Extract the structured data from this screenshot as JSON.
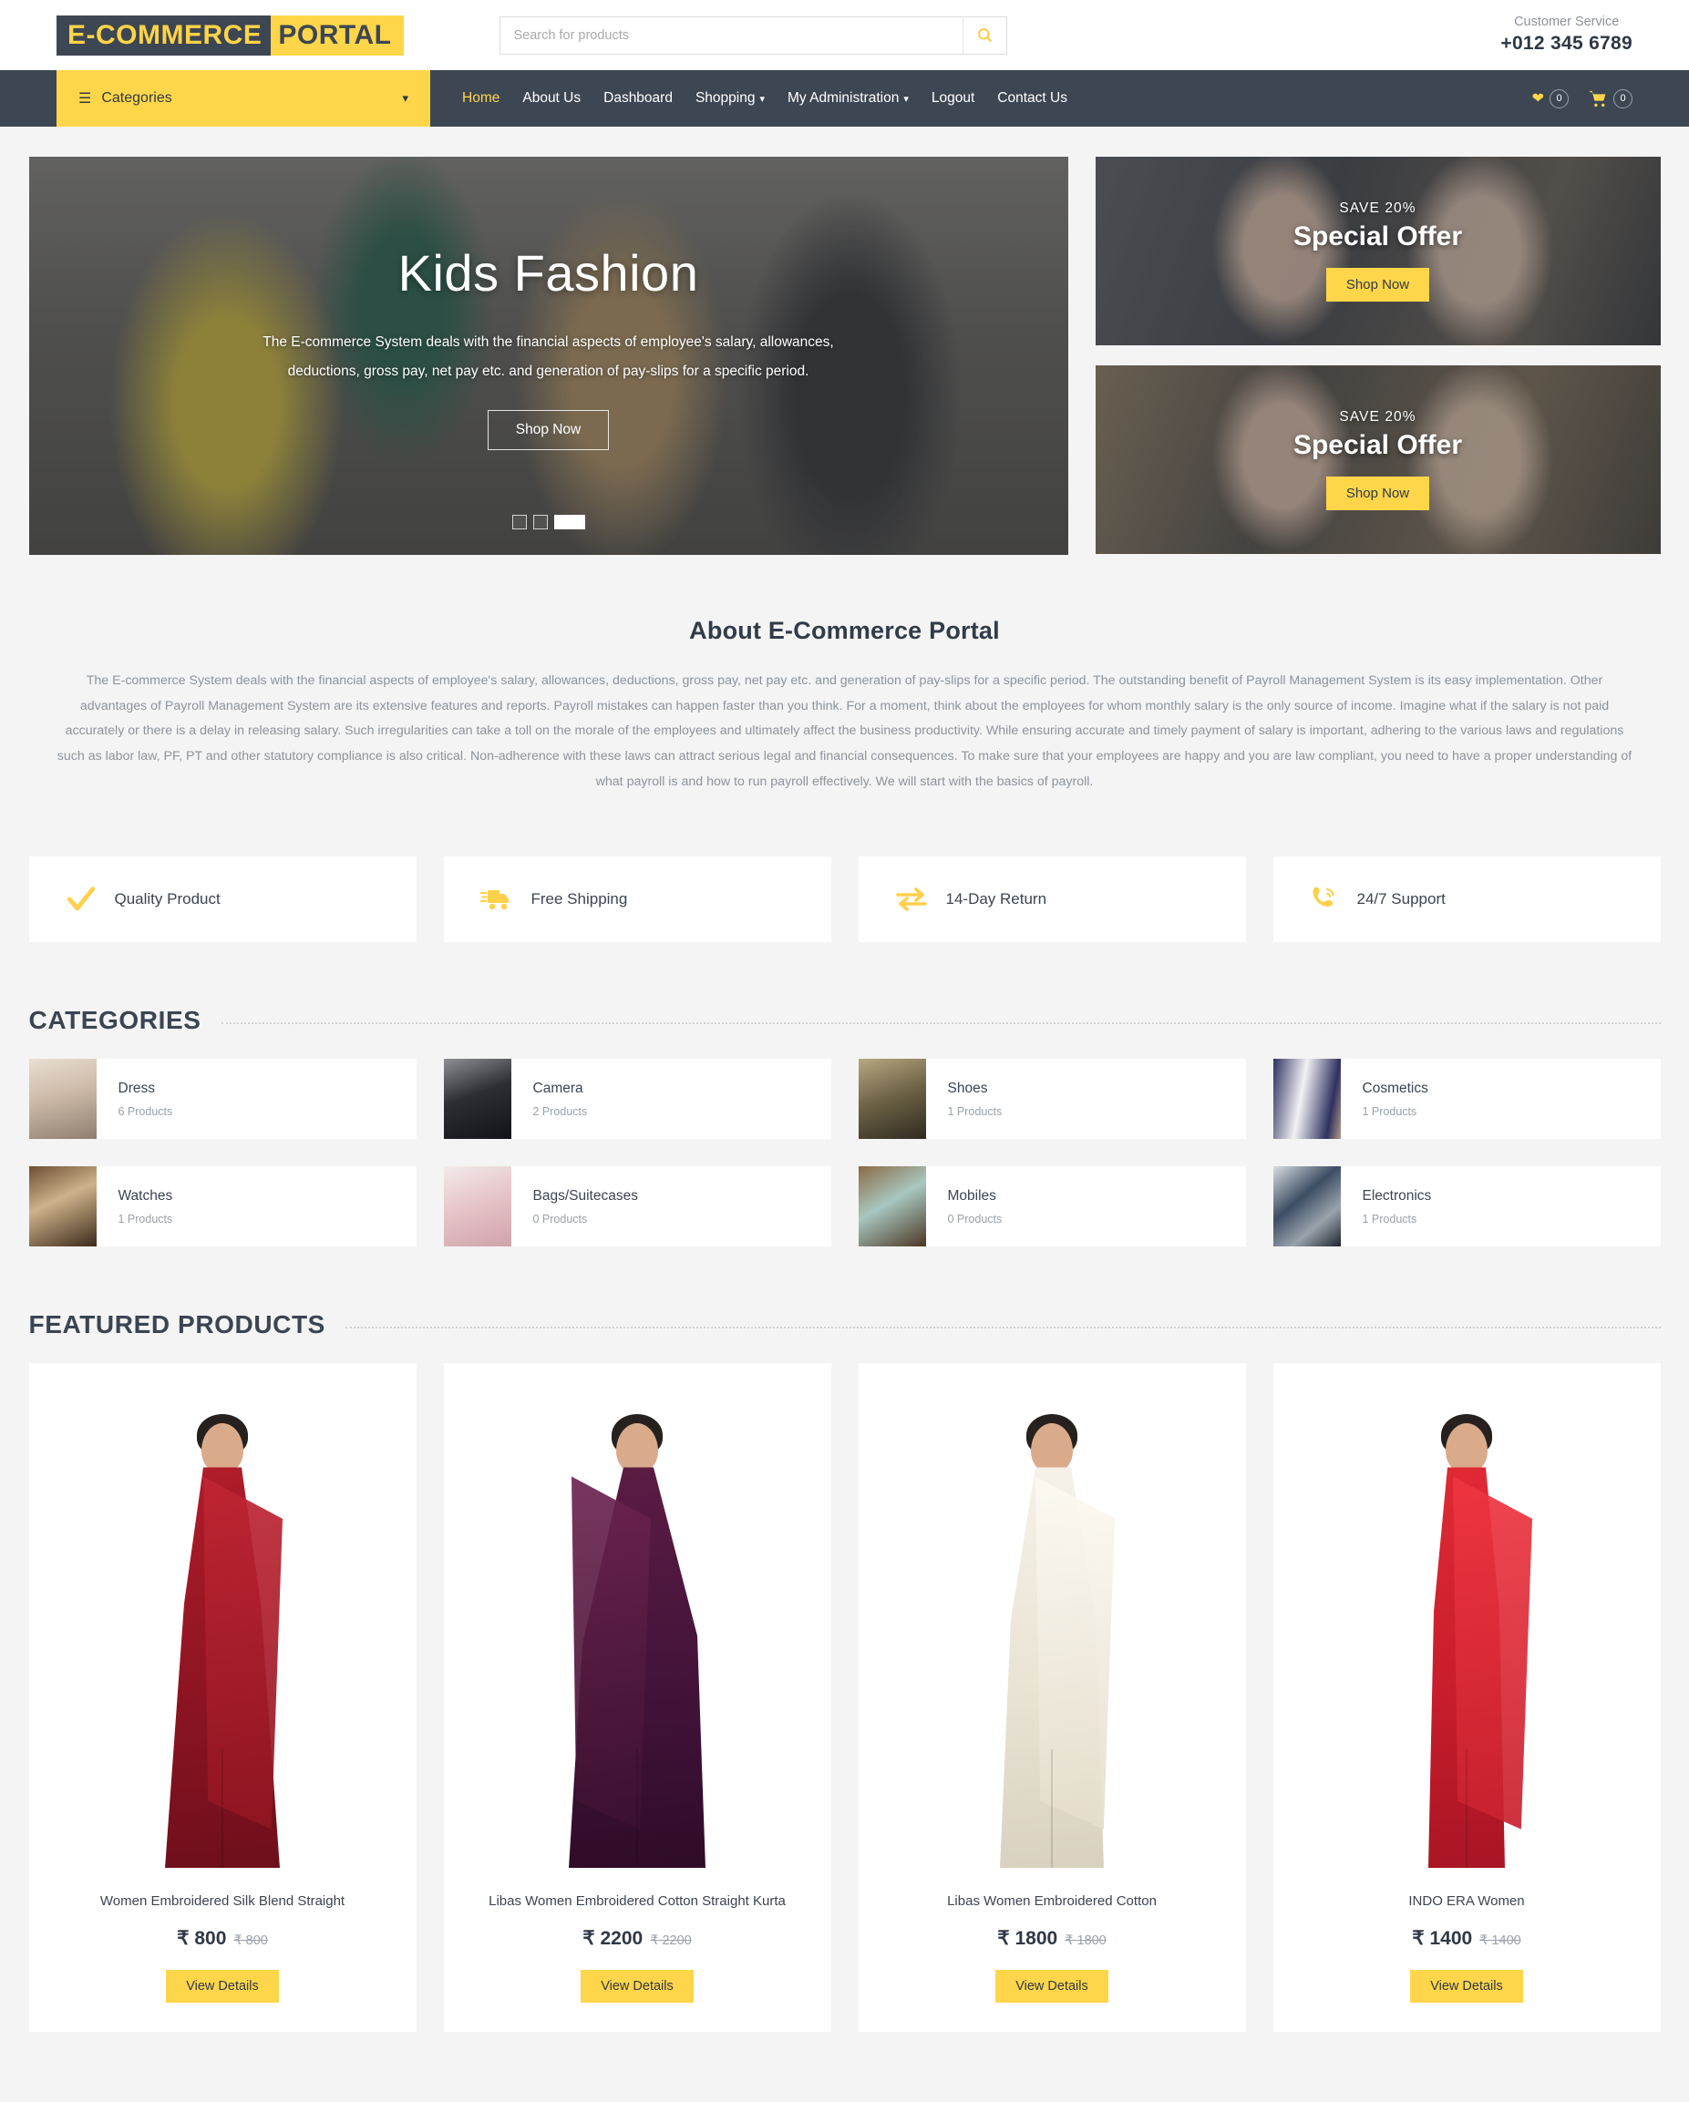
{
  "header": {
    "logo_part1": "E-COMMERCE",
    "logo_part2": "PORTAL",
    "search_placeholder": "Search for products",
    "search_value": "",
    "search_icon": "search-icon",
    "customer_service_label": "Customer Service",
    "customer_service_phone": "+012 345 6789"
  },
  "nav": {
    "categories_label": "Categories",
    "links": [
      {
        "label": "Home",
        "active": true,
        "caret": ""
      },
      {
        "label": "About Us",
        "active": false,
        "caret": ""
      },
      {
        "label": "Dashboard",
        "active": false,
        "caret": ""
      },
      {
        "label": "Shopping",
        "active": false,
        "caret": "⌄"
      },
      {
        "label": "My Administration",
        "active": false,
        "caret": "⌄"
      },
      {
        "label": "Logout",
        "active": false,
        "caret": ""
      },
      {
        "label": "Contact Us",
        "active": false,
        "caret": ""
      }
    ],
    "wishlist_count": "0",
    "cart_count": "0"
  },
  "hero": {
    "title": "Kids Fashion",
    "description": "The E-commerce System deals with the financial aspects of employee's salary, allowances, deductions, gross pay, net pay etc. and generation of pay-slips for a specific period.",
    "button": "Shop Now",
    "slides": [
      "slide-1",
      "slide-2",
      "slide-3"
    ],
    "active_slide": 2
  },
  "promos": [
    {
      "save": "SAVE 20%",
      "title": "Special Offer",
      "button": "Shop Now"
    },
    {
      "save": "SAVE 20%",
      "title": "Special Offer",
      "button": "Shop Now"
    }
  ],
  "about": {
    "title": "About E-Commerce Portal",
    "body": "The E-commerce System deals with the financial aspects of employee's salary, allowances, deductions, gross pay, net pay etc. and generation of pay-slips for a specific period. The outstanding benefit of Payroll Management System is its easy implementation. Other advantages of Payroll Management System are its extensive features and reports. Payroll mistakes can happen faster than you think. For a moment, think about the employees for whom monthly salary is the only source of income. Imagine what if the salary is not paid accurately or there is a delay in releasing salary. Such irregularities can take a toll on the morale of the employees and ultimately affect the business productivity. While ensuring accurate and timely payment of salary is important, adhering to the various laws and regulations such as labor law, PF, PT and other statutory compliance is also critical. Non-adherence with these laws can attract serious legal and financial consequences. To make sure that your employees are happy and you are law compliant, you need to have a proper understanding of what payroll is and how to run payroll effectively. We will start with the basics of payroll."
  },
  "features": [
    {
      "label": "Quality Product",
      "icon": "check-icon"
    },
    {
      "label": "Free Shipping",
      "icon": "truck-icon"
    },
    {
      "label": "14-Day Return",
      "icon": "exchange-arrows-icon"
    },
    {
      "label": "24/7 Support",
      "icon": "phone-support-icon"
    }
  ],
  "categories_section": {
    "title": "CATEGORIES",
    "items": [
      {
        "name": "Dress",
        "count": "6 Products",
        "thumb": "th-dress"
      },
      {
        "name": "Camera",
        "count": "2 Products",
        "thumb": "th-camera"
      },
      {
        "name": "Shoes",
        "count": "1 Products",
        "thumb": "th-shoes"
      },
      {
        "name": "Cosmetics",
        "count": "1 Products",
        "thumb": "th-cosmetics"
      },
      {
        "name": "Watches",
        "count": "1 Products",
        "thumb": "th-watches"
      },
      {
        "name": "Bags/Suitecases",
        "count": "0 Products",
        "thumb": "th-bags"
      },
      {
        "name": "Mobiles",
        "count": "0 Products",
        "thumb": "th-mobiles"
      },
      {
        "name": "Electronics",
        "count": "1 Products",
        "thumb": "th-electronics"
      }
    ]
  },
  "featured_section": {
    "title": "FEATURED PRODUCTS",
    "button_label": "View Details",
    "currency": "₹",
    "items": [
      {
        "name": "Women Embroidered Silk Blend Straight",
        "price": "₹ 800",
        "old_price": "₹ 800"
      },
      {
        "name": "Libas Women Embroidered Cotton Straight Kurta",
        "price": "₹ 2200",
        "old_price": "₹ 2200"
      },
      {
        "name": "Libas Women Embroidered Cotton",
        "price": "₹ 1800",
        "old_price": "₹ 1800"
      },
      {
        "name": "INDO ERA Women",
        "price": "₹ 1400",
        "old_price": "₹ 1400"
      }
    ]
  },
  "colors": {
    "accent": "#ffd64a",
    "dark": "#3d4653",
    "page_bg": "#f4f4f4",
    "muted_text": "#8d939c"
  }
}
